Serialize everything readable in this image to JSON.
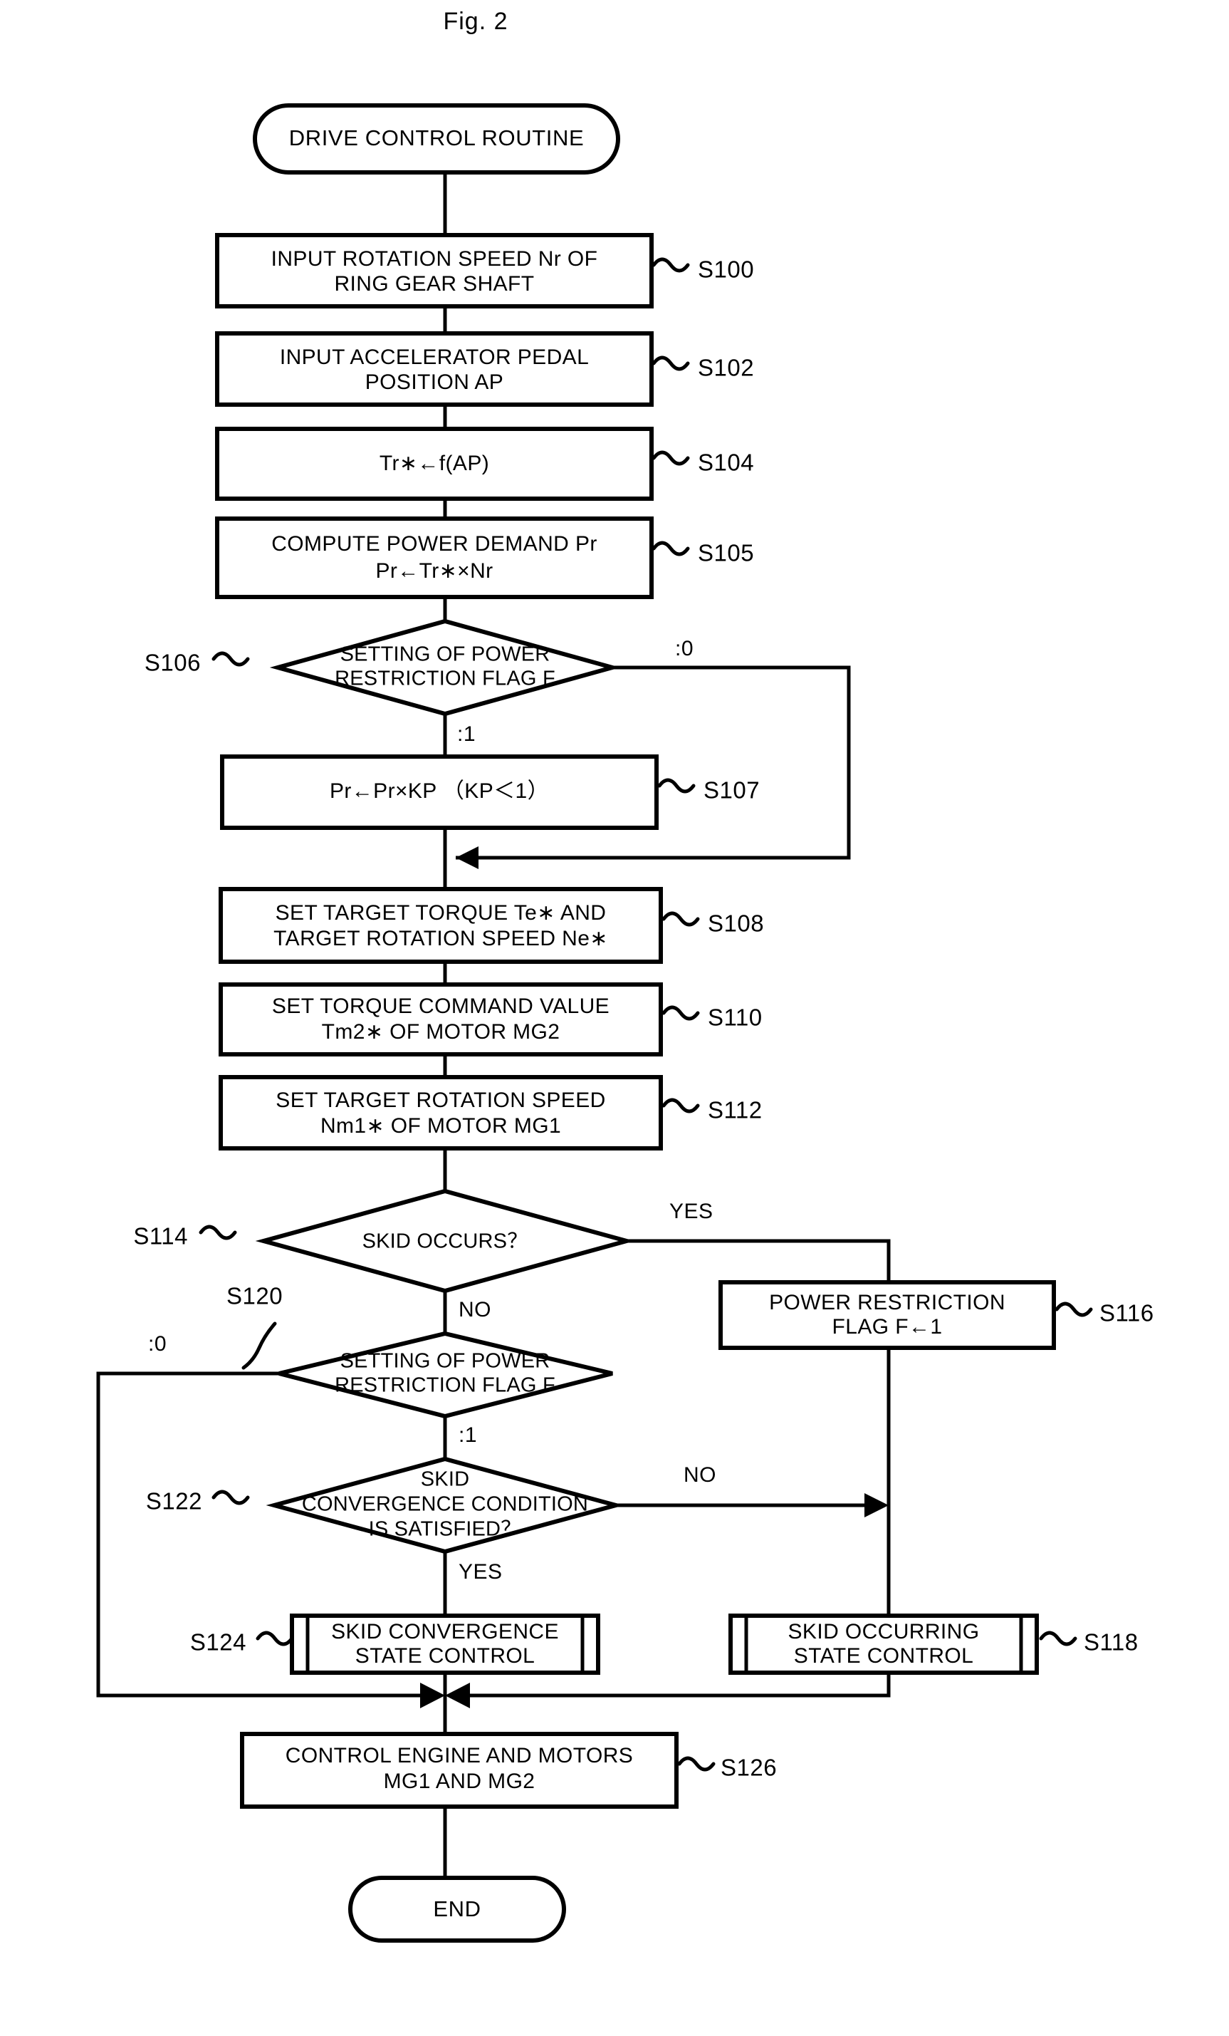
{
  "figure": {
    "title": "Fig. 2"
  },
  "nodes": {
    "start": {
      "label": "DRIVE CONTROL ROUTINE"
    },
    "s100": {
      "line1": "INPUT ROTATION SPEED Nr OF",
      "line2": "RING GEAR SHAFT",
      "step": "S100"
    },
    "s102": {
      "line1": "INPUT ACCELERATOR PEDAL",
      "line2": "POSITION AP",
      "step": "S102"
    },
    "s104": {
      "line1": "Tr∗←f(AP)",
      "line2": "",
      "step": "S104"
    },
    "s105": {
      "line1": "COMPUTE POWER DEMAND Pr",
      "line2": "Pr←Tr∗×Nr",
      "step": "S105"
    },
    "s106": {
      "line1": "SETTING OF POWER",
      "line2": "RESTRICTION FLAG F",
      "step": "S106",
      "branch_right": ":0",
      "branch_down": ":1"
    },
    "s107": {
      "line1": "Pr←Pr×KP （KP＜1）",
      "line2": "",
      "step": "S107"
    },
    "s108": {
      "line1": "SET TARGET TORQUE Te∗ AND",
      "line2": "TARGET ROTATION SPEED Ne∗",
      "step": "S108"
    },
    "s110": {
      "line1": "SET TORQUE COMMAND VALUE",
      "line2": "Tm2∗ OF MOTOR MG2",
      "step": "S110"
    },
    "s112": {
      "line1": "SET TARGET ROTATION SPEED",
      "line2": "Nm1∗ OF MOTOR MG1",
      "step": "S112"
    },
    "s114": {
      "line1": "SKID OCCURS？",
      "line2": "",
      "step": "S114",
      "branch_right": "YES",
      "branch_down": "NO"
    },
    "s116": {
      "line1": "POWER RESTRICTION",
      "line2": "FLAG F←1",
      "step": "S116"
    },
    "s118": {
      "line1": "SKID OCCURRING",
      "line2": "STATE CONTROL",
      "step": "S118"
    },
    "s120": {
      "line1": "SETTING OF POWER",
      "line2": "RESTRICTION FLAG F",
      "step": "S120",
      "branch_left": ":0",
      "branch_down": ":1"
    },
    "s122": {
      "line1": "SKID",
      "line2": "CONVERGENCE CONDITION",
      "line3": "IS SATISFIED？",
      "step": "S122",
      "branch_right": "NO",
      "branch_down": "YES"
    },
    "s124": {
      "line1": "SKID CONVERGENCE",
      "line2": "STATE CONTROL",
      "step": "S124"
    },
    "s126": {
      "line1": "CONTROL ENGINE AND MOTORS",
      "line2": "MG1 AND MG2",
      "step": "S126"
    },
    "end": {
      "label": "END"
    }
  },
  "colors": {
    "stroke": "#000000",
    "fill": "#ffffff",
    "background": "#ffffff"
  }
}
